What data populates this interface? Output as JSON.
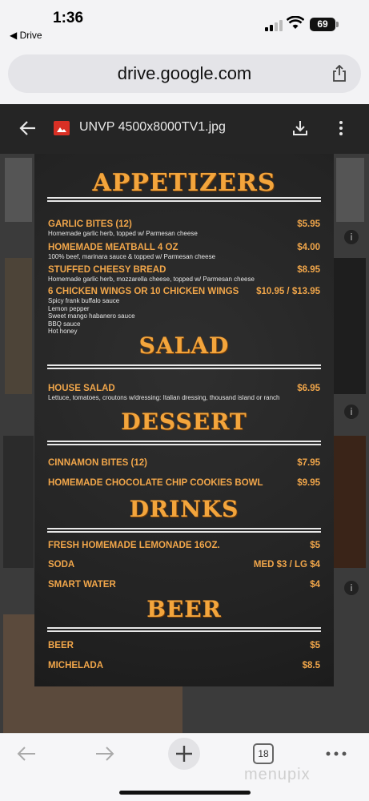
{
  "status": {
    "time": "1:36",
    "back_label": "◀ Drive",
    "battery": "69"
  },
  "browser": {
    "url": "drive.google.com",
    "tab_count": "18"
  },
  "viewer": {
    "file_name": "UNVP 4500x8000TV1.jpg"
  },
  "menu": {
    "appetizers": {
      "title": "APPETIZERS",
      "items": [
        {
          "name": "GARLIC BITES (12)",
          "desc": "Homemade garlic herb, topped w/ Parmesan cheese",
          "price": "$5.95"
        },
        {
          "name": "HOMEMADE MEATBALL 4 OZ",
          "desc": "100% beef, marinara sauce & topped w/ Parmesan cheese",
          "price": "$4.00"
        },
        {
          "name": "STUFFED CHEESY BREAD",
          "desc": "Homemade garlic herb, mozzarella cheese, topped w/ Parmesan cheese",
          "price": "$8.95"
        },
        {
          "name": "6 CHICKEN WINGS OR 10 CHICKEN WINGS",
          "desc": "Spicy frank buffalo sauce\nLemon pepper\nSweet mango habanero sauce\nBBQ sauce\nHot honey",
          "price": "$10.95  /  $13.95"
        }
      ]
    },
    "salad": {
      "title": "SALAD",
      "items": [
        {
          "name": "HOUSE SALAD",
          "desc": "Lettuce, tomatoes, croutons w/dressing: Italian dressing, thousand island or ranch",
          "price": "$6.95"
        }
      ]
    },
    "dessert": {
      "title": "DESSERT",
      "items": [
        {
          "name": "CINNAMON BITES (12)",
          "price": "$7.95"
        },
        {
          "name": "HOMEMADE CHOCOLATE CHIP COOKIES BOWL",
          "price": "$9.95"
        }
      ]
    },
    "drinks": {
      "title": "DRINKS",
      "items": [
        {
          "name": "FRESH HOMEMADE LEMONADE 16OZ.",
          "price": "$5"
        },
        {
          "name": "SODA",
          "price": "MED $3 / LG $4"
        },
        {
          "name": "SMART WATER",
          "price": "$4"
        }
      ]
    },
    "beer": {
      "title": "BEER",
      "items": [
        {
          "name": "BEER",
          "price": "$5"
        },
        {
          "name": "MICHELADA",
          "price": "$8.5"
        }
      ]
    }
  },
  "watermark": "menupix",
  "icons": {
    "signal": "signal-icon",
    "wifi": "wifi-icon",
    "battery": "battery-icon",
    "share": "share-icon",
    "back": "arrow-left-icon",
    "image_file": "image-file-icon",
    "download": "download-icon",
    "more": "more-vert-icon",
    "nav_back": "nav-back-icon",
    "nav_forward": "nav-forward-icon",
    "new_tab": "plus-icon",
    "menu": "more-horiz-icon"
  },
  "colors": {
    "accent": "#f1a64a",
    "viewer_bg": "#2a2a2a",
    "file_icon": "#d93025"
  }
}
